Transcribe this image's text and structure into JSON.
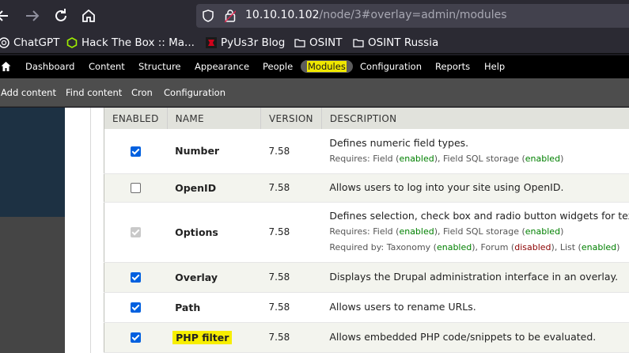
{
  "browser": {
    "url_host": "10.10.10.102",
    "url_path": "/node/3#overlay=admin/modules"
  },
  "bookmarks": [
    {
      "label": "ChatGPT",
      "icon": "chatgpt-icon"
    },
    {
      "label": "Hack The Box :: Ma...",
      "icon": "htb-icon"
    },
    {
      "label": "PyUs3r Blog",
      "icon": "blog-icon"
    },
    {
      "label": "OSINT",
      "icon": "folder-icon"
    },
    {
      "label": "OSINT Russia",
      "icon": "folder-icon"
    }
  ],
  "admin_menu": [
    "Dashboard",
    "Content",
    "Structure",
    "Appearance",
    "People",
    "Modules",
    "Configuration",
    "Reports",
    "Help"
  ],
  "active_menu": "Modules",
  "shortcuts": [
    "Add content",
    "Find content",
    "Cron",
    "Configuration"
  ],
  "table": {
    "headers": [
      "ENABLED",
      "NAME",
      "VERSION",
      "DESCRIPTION"
    ],
    "rows": [
      {
        "name": "Number",
        "version": "7.58",
        "enabled": "checked",
        "description": "Defines numeric field types.",
        "requires_label": "Requires: ",
        "requires": [
          {
            "name": "Field",
            "status": "enabled"
          },
          {
            "name": "Field SQL storage",
            "status": "enabled"
          }
        ]
      },
      {
        "name": "OpenID",
        "version": "7.58",
        "enabled": "unchecked",
        "description": "Allows users to log into your site using OpenID."
      },
      {
        "name": "Options",
        "version": "7.58",
        "enabled": "disabled",
        "description": "Defines selection, check box and radio button widgets for tex",
        "requires_label": "Requires: ",
        "requires": [
          {
            "name": "Field",
            "status": "enabled"
          },
          {
            "name": "Field SQL storage",
            "status": "enabled"
          }
        ],
        "required_by_label": "Required by: ",
        "required_by": [
          {
            "name": "Taxonomy",
            "status": "enabled"
          },
          {
            "name": "Forum",
            "status": "disabled"
          },
          {
            "name": "List",
            "status": "enabled"
          }
        ]
      },
      {
        "name": "Overlay",
        "version": "7.58",
        "enabled": "checked",
        "description": "Displays the Drupal administration interface in an overlay."
      },
      {
        "name": "Path",
        "version": "7.58",
        "enabled": "checked",
        "description": "Allows users to rename URLs."
      },
      {
        "name": "PHP filter",
        "version": "7.58",
        "enabled": "checked",
        "highlighted": true,
        "description": "Allows embedded PHP code/snippets to be evaluated."
      }
    ]
  },
  "colors": {
    "status_enabled": "#008000",
    "status_disabled": "#8b0000",
    "highlight": "#f7ee00",
    "checkbox": "#0060df"
  }
}
